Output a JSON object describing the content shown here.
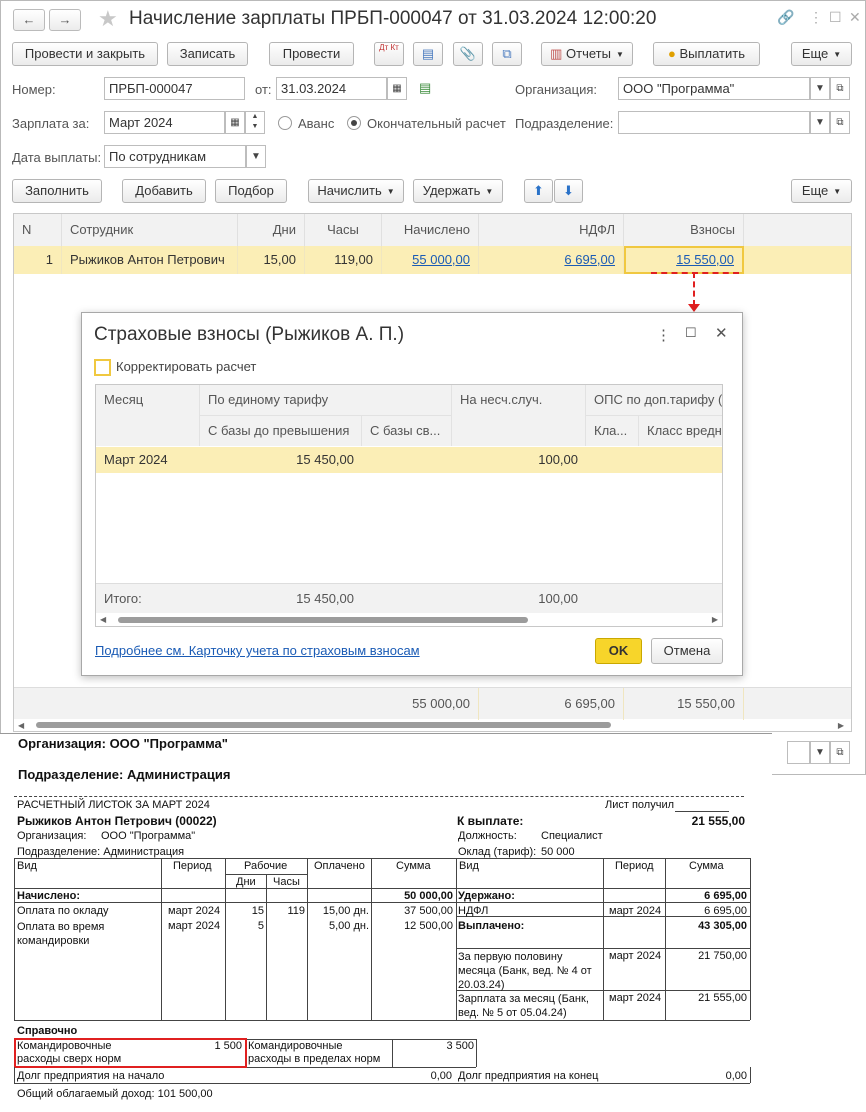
{
  "window": {
    "title": "Начисление зарплаты ПРБП-000047 от 31.03.2024 12:00:20",
    "back": "←",
    "forward": "→"
  },
  "toolbar": {
    "post_close": "Провести и закрыть",
    "write": "Записать",
    "post": "Провести",
    "dtkt": "Дт Кт",
    "reports": "Отчеты",
    "pay": "Выплатить",
    "more": "Еще"
  },
  "form": {
    "number_label": "Номер:",
    "number": "ПРБП-000047",
    "date_label": "от:",
    "date": "31.03.2024",
    "org_label": "Организация:",
    "org": "ООО \"Программа\"",
    "salary_for_label": "Зарплата за:",
    "salary_for": "Март 2024",
    "advance": "Аванс",
    "final": "Окончательный расчет",
    "dept_label": "Подразделение:",
    "dept": "",
    "pay_date_label": "Дата выплаты:",
    "pay_date": "По сотрудникам"
  },
  "table_toolbar": {
    "fill": "Заполнить",
    "add": "Добавить",
    "select": "Подбор",
    "accrue": "Начислить",
    "withhold": "Удержать",
    "more": "Еще"
  },
  "grid": {
    "headers": [
      "N",
      "Сотрудник",
      "Дни",
      "Часы",
      "Начислено",
      "НДФЛ",
      "Взносы"
    ],
    "row": {
      "n": "1",
      "employee": "Рыжиков Антон Петрович",
      "days": "15,00",
      "hours": "119,00",
      "accrued": "55 000,00",
      "ndfl": "6 695,00",
      "contrib": "15 550,00"
    },
    "totals": {
      "accrued": "55 000,00",
      "ndfl": "6 695,00",
      "contrib": "15 550,00"
    }
  },
  "dialog": {
    "title": "Страховые взносы (Рыжиков А. П.)",
    "adjust": "Корректировать расчет",
    "headers": {
      "month": "Месяц",
      "single_tariff": "По единому тарифу",
      "base_before": "С базы до превышения",
      "base_over": "С базы св...",
      "accident": "На несч.случ.",
      "ops_extra": "ОПС по доп.тарифу (в",
      "cls": "Кла...",
      "harmful": "Класс вредн"
    },
    "row": {
      "month": "Март 2024",
      "base_before": "15 450,00",
      "accident": "100,00"
    },
    "total": {
      "label": "Итого:",
      "base_before": "15 450,00",
      "accident": "100,00"
    },
    "link": "Подробнее см. Карточку учета по страховым взносам",
    "ok": "OK",
    "cancel": "Отмена"
  },
  "payslip": {
    "org_line": "Организация: ООО \"Программа\"",
    "dept_line": "Подразделение: Администрация",
    "heading": "РАСЧЕТНЫЙ ЛИСТОК ЗА МАРТ 2024",
    "received": "Лист получил",
    "employee": "Рыжиков Антон Петрович (00022)",
    "to_pay_label": "К выплате:",
    "to_pay": "21 555,00",
    "org_l": "Организация:",
    "org_v": "ООО \"Программа\"",
    "position_l": "Должность:",
    "position_v": "Специалист",
    "dept_l": "Подразделение: Администрация",
    "salary_l": "Оклад (тариф):",
    "salary_v": "50 000",
    "cols_left": {
      "kind": "Вид",
      "period": "Период",
      "working": "Рабочие",
      "days": "Дни",
      "hours": "Часы",
      "paid": "Оплачено",
      "sum": "Сумма"
    },
    "cols_right": {
      "kind": "Вид",
      "period": "Период",
      "sum": "Сумма"
    },
    "accrued_label": "Начислено:",
    "accrued_total": "50 000,00",
    "withheld_label": "Удержано:",
    "withheld_total": "6 695,00",
    "rows_left": [
      {
        "kind": "Оплата по окладу",
        "period": "март 2024",
        "days": "15",
        "hours": "119",
        "paid": "15,00 дн.",
        "sum": "37 500,00"
      },
      {
        "kind": "Оплата во время командировки",
        "period": "март 2024",
        "days": "5",
        "hours": "",
        "paid": "5,00 дн.",
        "sum": "12 500,00"
      }
    ],
    "ndfl": {
      "kind": "НДФЛ",
      "period": "март 2024",
      "sum": "6 695,00"
    },
    "paid_label": "Выплачено:",
    "paid_total": "43 305,00",
    "payouts": [
      {
        "kind": "За первую половину месяца (Банк, вед. № 4 от 20.03.24)",
        "period": "март 2024",
        "sum": "21 750,00"
      },
      {
        "kind": "Зарплата за месяц (Банк, вед. № 5 от 05.04.24)",
        "period": "март 2024",
        "sum": "21 555,00"
      }
    ],
    "reference": "Справочно",
    "trip_over_label": "Командировочные расходы сверх норм",
    "trip_over": "1 500",
    "trip_norm_label": "Командировочные расходы в пределах норм",
    "trip_norm": "3 500",
    "debt_start_label": "Долг предприятия на начало",
    "debt_start": "0,00",
    "debt_end_label": "Долг предприятия на конец",
    "debt_end": "0,00",
    "income": "Общий облагаемый доход: 101 500,00"
  },
  "colors": {
    "selected_row": "#fbeeb6",
    "ok_button": "#f7d52a",
    "link": "#1a5bb5",
    "annotation": "#e02020"
  }
}
